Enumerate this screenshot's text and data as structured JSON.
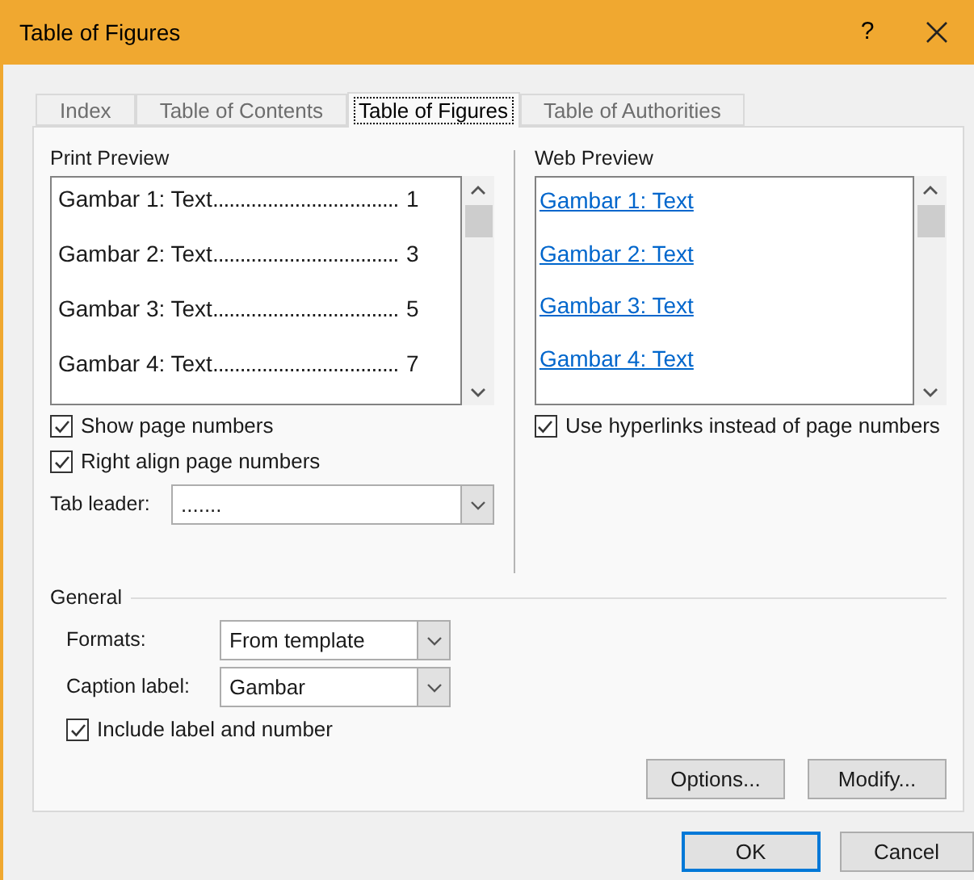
{
  "window": {
    "title": "Table of Figures",
    "help": "?"
  },
  "tabs": [
    {
      "label": "Index",
      "selected": false
    },
    {
      "label": "Table of Contents",
      "selected": false
    },
    {
      "label": "Table of Figures",
      "selected": true
    },
    {
      "label": "Table of Authorities",
      "selected": false
    }
  ],
  "print_preview": {
    "label": "Print Preview",
    "entries": [
      {
        "text": "Gambar 1: Text",
        "leader": "..................................",
        "page": "1"
      },
      {
        "text": "Gambar 2: Text",
        "leader": "..................................",
        "page": "3"
      },
      {
        "text": "Gambar 3: Text",
        "leader": "..................................",
        "page": "5"
      },
      {
        "text": "Gambar 4: Text",
        "leader": "..................................",
        "page": "7"
      }
    ]
  },
  "print_options": [
    {
      "label": "Show page numbers",
      "checked": true
    },
    {
      "label": "Right align page numbers",
      "checked": true
    }
  ],
  "tab_leader": {
    "label": "Tab leader:",
    "value": "......."
  },
  "web_preview": {
    "label": "Web Preview",
    "entries": [
      "Gambar 1: Text",
      "Gambar 2: Text",
      "Gambar 3: Text",
      "Gambar 4: Text"
    ]
  },
  "web_option": {
    "label": "Use hyperlinks instead of page numbers",
    "checked": true
  },
  "general": {
    "title": "General",
    "fields": [
      {
        "label": "Formats:",
        "value": "From template"
      },
      {
        "label": "Caption label:",
        "value": "Gambar"
      }
    ],
    "include": {
      "label": "Include label and number",
      "checked": true
    }
  },
  "panel_buttons": [
    "Options...",
    "Modify..."
  ],
  "buttons": [
    {
      "label": "OK",
      "default": true
    },
    {
      "label": "Cancel",
      "default": false
    }
  ]
}
